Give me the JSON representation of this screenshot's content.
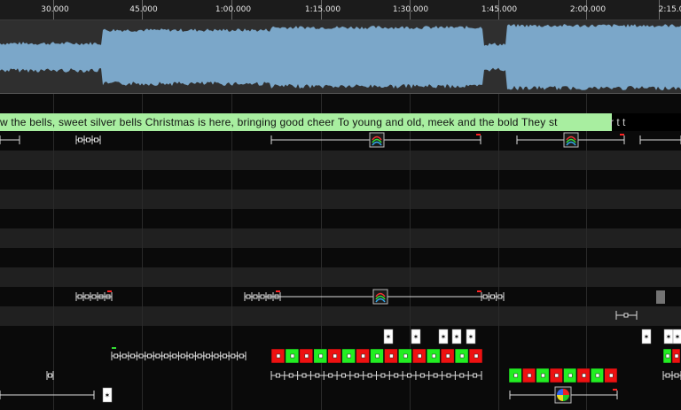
{
  "ruler": {
    "ticks": [
      {
        "label": "30.000"
      },
      {
        "label": "45.000"
      },
      {
        "label": "1:00.000"
      },
      {
        "label": "1:15.000"
      },
      {
        "label": "1:30.000"
      },
      {
        "label": "1:45.000"
      },
      {
        "label": "2:00.000"
      },
      {
        "label": "2:15.0"
      }
    ]
  },
  "lyrics": {
    "text": "w the bells, sweet silver bells Christmas is here, bringing good cheer To young and old, meek and the bold They st",
    "overflow": "r t t"
  },
  "colors": {
    "waveform": "#7ba7c9",
    "lyric_bg": "#a8eea0",
    "effect_red": "#ee1111",
    "effect_green": "#22ee22",
    "marker_red": "#ff2222"
  }
}
